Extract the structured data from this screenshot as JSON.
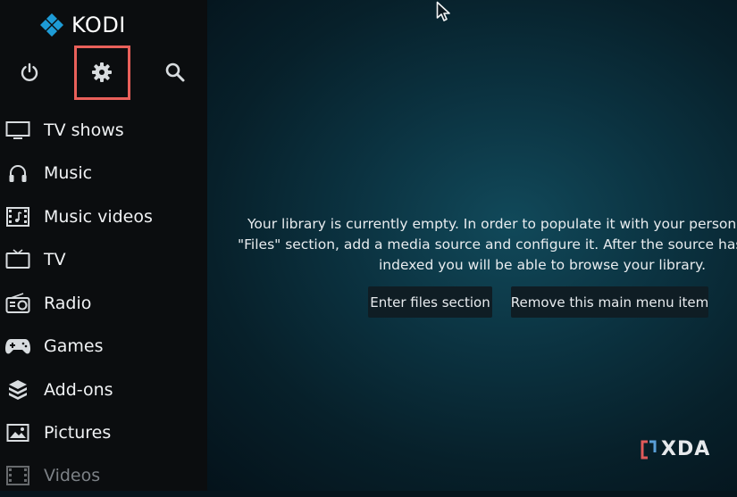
{
  "app": {
    "name": "KODI"
  },
  "top_bar": {
    "power_icon": "power-icon",
    "settings_icon": "gear-icon",
    "search_icon": "search-icon"
  },
  "sidebar": {
    "items": [
      {
        "label": "TV shows",
        "icon": "monitor-icon"
      },
      {
        "label": "Music",
        "icon": "headphones-icon"
      },
      {
        "label": "Music videos",
        "icon": "film-music-icon"
      },
      {
        "label": "TV",
        "icon": "tv-icon"
      },
      {
        "label": "Radio",
        "icon": "radio-icon"
      },
      {
        "label": "Games",
        "icon": "gamepad-icon"
      },
      {
        "label": "Add-ons",
        "icon": "box-icon"
      },
      {
        "label": "Pictures",
        "icon": "picture-icon"
      },
      {
        "label": "Videos",
        "icon": "film-icon"
      }
    ]
  },
  "main": {
    "message_line1": "Your library is currently empty. In order to populate it with your personal",
    "message_line2": "\"Files\" section, add a media source and configure it. After the source has b",
    "message_line3": "indexed you will be able to browse your library.",
    "enter_files_label": "Enter files section",
    "remove_item_label": "Remove this main menu item"
  },
  "watermark": {
    "text": "XDA"
  },
  "colors": {
    "highlight_box": "#e9605a",
    "kodi_blue": "#1d9bd6"
  }
}
